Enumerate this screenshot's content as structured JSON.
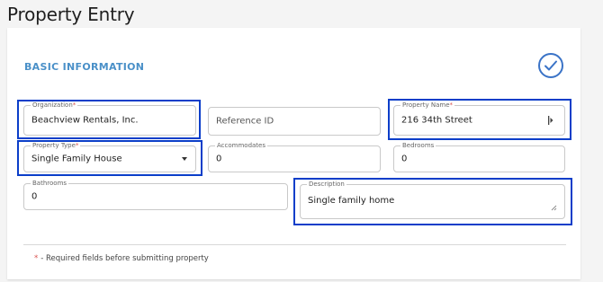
{
  "page": {
    "title": "Property Entry"
  },
  "section": {
    "title": "BASIC INFORMATION"
  },
  "fields": {
    "organization": {
      "label": "Organization",
      "required_mark": "*",
      "value": "Beachview Rentals, Inc."
    },
    "reference_id": {
      "placeholder": "Reference ID",
      "value": ""
    },
    "property_name": {
      "label": "Property Name",
      "required_mark": "*",
      "value": "216 34th Street"
    },
    "property_type": {
      "label": "Property Type",
      "required_mark": "*",
      "value": "Single Family House"
    },
    "accommodates": {
      "label": "Accommodates",
      "value": "0"
    },
    "bedrooms": {
      "label": "Bedrooms",
      "value": "0"
    },
    "bathrooms": {
      "label": "Bathrooms",
      "value": "0"
    },
    "description": {
      "label": "Description",
      "value": "Single family home"
    }
  },
  "footnote": {
    "star": "*",
    "text": "- Required fields before submitting property"
  },
  "icons": {
    "submit": "check-circle-icon",
    "dropdown": "chevron-down-icon",
    "resize": "resize-handle-icon",
    "cursor": "text-cursor-icon"
  },
  "colors": {
    "accent": "#4a90c8",
    "highlight": "#0b3ec9",
    "required": "#d9534f",
    "check": "#3a73c7"
  }
}
